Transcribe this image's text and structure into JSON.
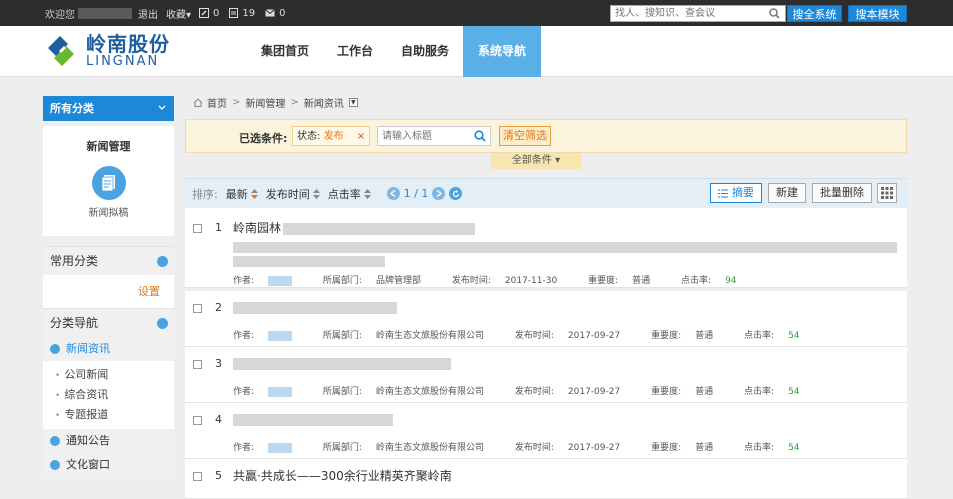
{
  "topbar": {
    "welcome": "欢迎您",
    "logout": "退出",
    "favorites": "收藏▾",
    "edit_count": "0",
    "doc_count": "19",
    "mail_count": "0",
    "search_placeholder": "找人、搜知识、查会议",
    "search_all": "搜全系统",
    "search_module": "搜本模块"
  },
  "logo": {
    "cn": "岭南股份",
    "en": "LINGNAN"
  },
  "nav": [
    {
      "label": "集团首页"
    },
    {
      "label": "工作台"
    },
    {
      "label": "自助服务"
    },
    {
      "label": "系统导航"
    }
  ],
  "sidebar": {
    "all_categories": "所有分类",
    "card_title": "新闻管理",
    "card_item": "新闻拟稿",
    "common": "常用分类",
    "settings": "设置",
    "nav_section": "分类导航",
    "news": "新闻资讯",
    "news_items": [
      "公司新闻",
      "综合资讯",
      "专题报道"
    ],
    "notice": "通知公告",
    "culture": "文化窗口"
  },
  "breadcrumb": [
    "首页",
    "新闻管理",
    "新闻资讯"
  ],
  "filter": {
    "label": "已选条件:",
    "tag_key": "状态:",
    "tag_value": "发布",
    "tag_close": "×",
    "title_placeholder": "请输入标题",
    "clear": "清空筛选",
    "all_conditions": "全部条件 ▾"
  },
  "toolbar": {
    "sort_label": "排序:",
    "sort_latest": "最新",
    "sort_time": "发布时间",
    "sort_hits": "点击率",
    "page": "1 / 1",
    "summary": "摘要",
    "new": "新建",
    "batch_delete": "批量删除"
  },
  "meta_labels": {
    "author": "作者:",
    "dept": "所属部门:",
    "time": "发布时间:",
    "importance": "重要度:",
    "hits": "点击率:"
  },
  "rows": [
    {
      "num": "1",
      "title": "岭南园林",
      "dept": "品牌管理部",
      "time": "2017-11-30",
      "importance": "普通",
      "hits": "94"
    },
    {
      "num": "2",
      "title": "",
      "dept": "岭南生态文旅股份有限公司",
      "time": "2017-09-27",
      "importance": "普通",
      "hits": "54"
    },
    {
      "num": "3",
      "title": "",
      "dept": "岭南生态文旅股份有限公司",
      "time": "2017-09-27",
      "importance": "普通",
      "hits": "54"
    },
    {
      "num": "4",
      "title": "",
      "dept": "岭南生态文旅股份有限公司",
      "time": "2017-09-27",
      "importance": "普通",
      "hits": "54"
    },
    {
      "num": "5",
      "title": "共赢·共成长——300余行业精英齐聚岭南",
      "dept": "",
      "time": "",
      "importance": "",
      "hits": ""
    }
  ],
  "colors": {
    "accent": "#1e88d8",
    "nav_active": "#5ab0e6",
    "orange": "#e07a1e",
    "hits": "#3a9a3a"
  }
}
